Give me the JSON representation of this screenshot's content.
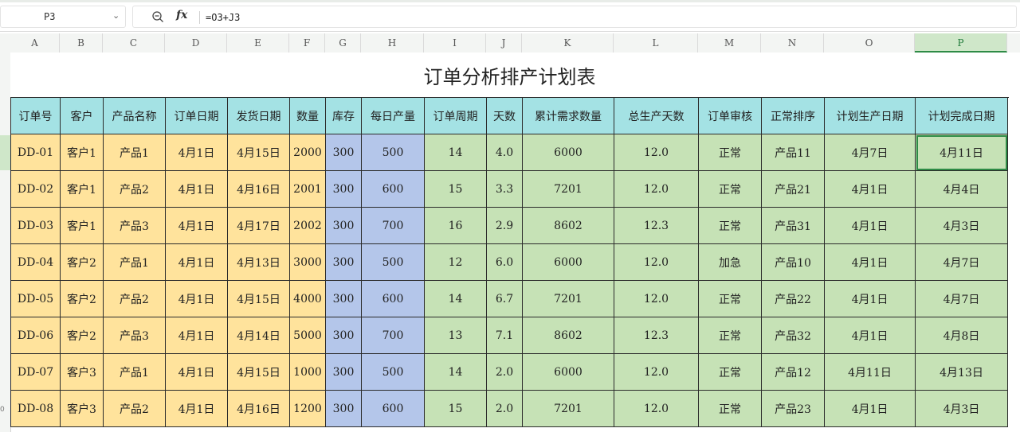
{
  "formula_bar": {
    "cell_ref": "P3",
    "formula": "=O3+J3",
    "fx_label": "fx",
    "dropdown_icon": "chevron-down-icon",
    "zoom_icon": "zoom-icon"
  },
  "columns": [
    "A",
    "B",
    "C",
    "D",
    "E",
    "F",
    "G",
    "H",
    "I",
    "J",
    "K",
    "L",
    "M",
    "N",
    "O",
    "P"
  ],
  "active_column": "P",
  "row_numbers": {
    "r10": "0"
  },
  "sheet": {
    "title": "订单分析排产计划表",
    "headers": [
      "订单号",
      "客户",
      "产品名称",
      "订单日期",
      "发货日期",
      "数量",
      "库存",
      "每日产量",
      "订单周期",
      "天数",
      "累计需求数量",
      "总生产天数",
      "订单审核",
      "正常排序",
      "计划生产日期",
      "计划完成日期"
    ],
    "rows": [
      [
        "DD-01",
        "客户1",
        "产品1",
        "4月1日",
        "4月15日",
        "2000",
        "300",
        "500",
        "14",
        "4.0",
        "6000",
        "12.0",
        "正常",
        "产品11",
        "4月7日",
        "4月11日"
      ],
      [
        "DD-02",
        "客户1",
        "产品2",
        "4月1日",
        "4月16日",
        "2001",
        "300",
        "600",
        "15",
        "3.3",
        "7201",
        "12.0",
        "正常",
        "产品21",
        "4月1日",
        "4月4日"
      ],
      [
        "DD-03",
        "客户1",
        "产品3",
        "4月1日",
        "4月17日",
        "2002",
        "300",
        "700",
        "16",
        "2.9",
        "8602",
        "12.3",
        "正常",
        "产品31",
        "4月1日",
        "4月3日"
      ],
      [
        "DD-04",
        "客户2",
        "产品1",
        "4月1日",
        "4月13日",
        "3000",
        "300",
        "500",
        "12",
        "6.0",
        "6000",
        "12.0",
        "加急",
        "产品10",
        "4月1日",
        "4月7日"
      ],
      [
        "DD-05",
        "客户2",
        "产品2",
        "4月1日",
        "4月15日",
        "4000",
        "300",
        "600",
        "14",
        "6.7",
        "7201",
        "12.0",
        "正常",
        "产品22",
        "4月1日",
        "4月7日"
      ],
      [
        "DD-06",
        "客户2",
        "产品3",
        "4月1日",
        "4月14日",
        "5000",
        "300",
        "700",
        "13",
        "7.1",
        "8602",
        "12.3",
        "正常",
        "产品32",
        "4月1日",
        "4月8日"
      ],
      [
        "DD-07",
        "客户3",
        "产品1",
        "4月1日",
        "4月15日",
        "1000",
        "300",
        "500",
        "14",
        "2.0",
        "6000",
        "12.0",
        "正常",
        "产品12",
        "4月11日",
        "4月13日"
      ],
      [
        "DD-08",
        "客户3",
        "产品2",
        "4月1日",
        "4月16日",
        "1200",
        "300",
        "600",
        "15",
        "2.0",
        "7201",
        "12.0",
        "正常",
        "产品23",
        "4月1日",
        "4月3日"
      ]
    ]
  },
  "colors": {
    "header_fill": "#a4e2e4",
    "yellow_fill": "#ffe39c",
    "blue_fill": "#b4c6ea",
    "green_fill": "#c6e2b6",
    "selection": "#2e8b46"
  }
}
